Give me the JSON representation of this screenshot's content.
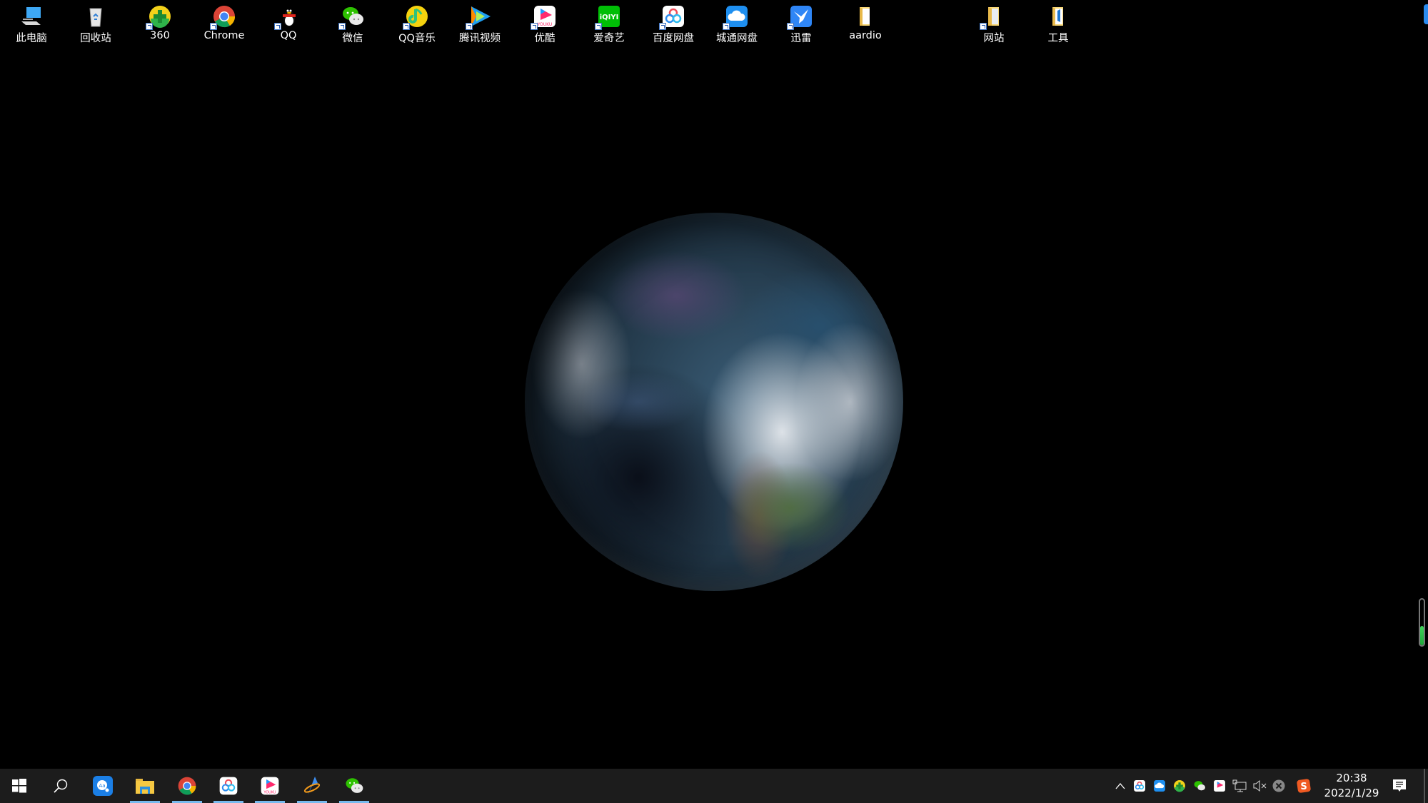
{
  "desktop": {
    "icons": [
      {
        "label": "此电脑",
        "icon": "this-pc-icon",
        "shortcut": false
      },
      {
        "label": "回收站",
        "icon": "recycle-bin-icon",
        "shortcut": false
      },
      {
        "label": "360",
        "icon": "360-safe-icon",
        "shortcut": true
      },
      {
        "label": "Chrome",
        "icon": "chrome-icon",
        "shortcut": true
      },
      {
        "label": "QQ",
        "icon": "qq-penguin-icon",
        "shortcut": true
      },
      {
        "label": "微信",
        "icon": "wechat-icon",
        "shortcut": true
      },
      {
        "label": "QQ音乐",
        "icon": "qq-music-icon",
        "shortcut": true
      },
      {
        "label": "腾讯视频",
        "icon": "tencent-video-icon",
        "shortcut": true
      },
      {
        "label": "优酷",
        "icon": "youku-icon",
        "shortcut": true
      },
      {
        "label": "爱奇艺",
        "icon": "iqiyi-icon",
        "shortcut": true
      },
      {
        "label": "百度网盘",
        "icon": "baidu-netdisk-icon",
        "shortcut": true
      },
      {
        "label": "城通网盘",
        "icon": "ctfile-cloud-icon",
        "shortcut": true
      },
      {
        "label": "迅雷",
        "icon": "xunlei-icon",
        "shortcut": true
      },
      {
        "label": "aardio",
        "icon": "folder-icon",
        "shortcut": false
      },
      {
        "label": "网站",
        "icon": "folder-icon",
        "shortcut": true
      },
      {
        "label": "工具",
        "icon": "folder-icon",
        "shortcut": false
      }
    ],
    "wallpaper": "earth-globe",
    "volume_meter_level": 0.42
  },
  "taskbar": {
    "start": "windows-start-icon",
    "search": "search-icon",
    "pinned": [
      {
        "name": "dictionary-app",
        "running": false
      },
      {
        "name": "file-explorer",
        "running": true
      },
      {
        "name": "chrome",
        "running": true
      },
      {
        "name": "baidu-netdisk",
        "running": true
      },
      {
        "name": "youku",
        "running": true
      },
      {
        "name": "aardio",
        "running": true
      },
      {
        "name": "wechat",
        "running": true
      }
    ],
    "tray": {
      "icons": [
        "show-hidden-icons",
        "baidu-netdisk",
        "ctfile-cloud",
        "360-safe",
        "wechat",
        "youku",
        "network",
        "volume-muted",
        "error-status",
        "sogou-input"
      ],
      "time": "20:38",
      "date": "2022/1/29"
    }
  },
  "colors": {
    "taskbar_bg": "#1c1c1c",
    "running_indicator": "#76b9ed",
    "edge_tab": "#2b8cf0",
    "volume_fill": "#2fbf4a"
  }
}
